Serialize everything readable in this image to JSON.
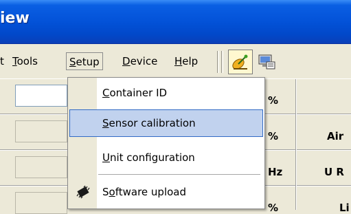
{
  "window": {
    "title": "iew"
  },
  "menu": {
    "items": [
      {
        "key": "edit",
        "label": "t"
      },
      {
        "key": "tools",
        "label": "Tools",
        "mnemonic": "T",
        "rest": "ools"
      },
      {
        "key": "setup",
        "label": "Setup",
        "mnemonic": "S",
        "rest": "etup"
      },
      {
        "key": "device",
        "label": "Device",
        "mnemonic": "D",
        "rest": "evice"
      },
      {
        "key": "help",
        "label": "Help",
        "mnemonic": "H",
        "rest": "elp"
      }
    ]
  },
  "toolbar": {
    "buttons": [
      {
        "icon": "satellite-dish-icon",
        "pressed": true
      },
      {
        "icon": "settings-computer-icon",
        "pressed": false
      }
    ]
  },
  "setup_menu": {
    "items": [
      {
        "label": "Container ID",
        "pre": "",
        "mn": "C",
        "post": "ontainer ID",
        "highlighted": false
      },
      {
        "label": "Sensor calibration",
        "pre": "",
        "mn": "S",
        "post": "ensor calibration",
        "highlighted": true
      },
      {
        "label": "Unit configuration",
        "pre": "",
        "mn": "U",
        "post": "nit configuration",
        "highlighted": false
      },
      {
        "label": "Software upload",
        "pre": "S",
        "mn": "o",
        "post": "ftware upload",
        "highlighted": false,
        "icon": "chip-icon"
      }
    ]
  },
  "panel": {
    "units": [
      "%",
      "%",
      "Hz",
      "%"
    ],
    "labels": [
      "Air",
      "U R",
      "Li"
    ]
  },
  "colors": {
    "titlebar": "#0352d8",
    "menu_highlight": "#c1d2ee",
    "menu_highlight_border": "#316ac5",
    "face": "#ece9d8"
  }
}
